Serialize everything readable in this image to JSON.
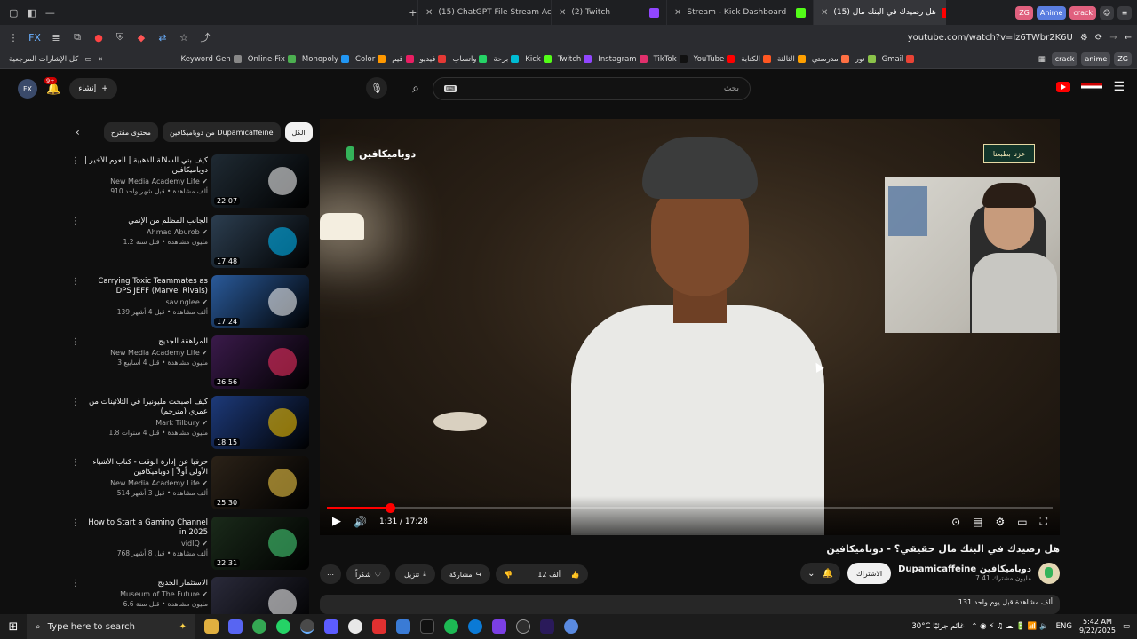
{
  "browser": {
    "tabs": [
      {
        "title": "(15) ChatGPT File Stream Acce",
        "color": "#ff0000",
        "active": false
      },
      {
        "title": "(2) Twitch",
        "color": "#9146ff",
        "active": false
      },
      {
        "title": "Stream - Kick Dashboard",
        "color": "#53fc18",
        "active": false
      },
      {
        "title": "هل رصيدك في البنك مال (15)",
        "color": "#ff0000",
        "active": true
      }
    ],
    "pills": [
      "ZG",
      "Anime",
      "crack"
    ],
    "url": "youtube.com/watch?v=lz6TWbr2K6U",
    "bookmarks": [
      "Keyword Gen",
      "Online-Fix",
      "Monopoly",
      "Color",
      "قيم",
      "فيديو",
      "واتساب",
      "برحة",
      "Kick",
      "Twitch",
      "Instagram",
      "TikTok",
      "YouTube",
      "الكتابة",
      "الثالثة",
      "مدرستي",
      "نور",
      "Gmail"
    ],
    "bookmarks_right": [
      "crack",
      "anime",
      "ZG"
    ],
    "other_bookmarks": "كل الإشارات المرجعية"
  },
  "masthead": {
    "create_label": "إنشاء",
    "notif_count": "9+",
    "search_placeholder": "بحث",
    "search_chip": "⌨"
  },
  "chips": [
    "الكل",
    "من دوباميكافين Dupamicaffeine",
    "محتوى مقترح"
  ],
  "recommendations": [
    {
      "title": "كيف بني السلالة الذهبية | العوم الأخير | دوباميكافين",
      "channel": "New Media Academy Life",
      "views": "910 ألف مشاهدة • قبل شهر واحد",
      "duration": "22:07",
      "thumb": "#1f2a33",
      "accent": "#ffffff"
    },
    {
      "title": "الجانب المظلم من الإنمي",
      "channel": "Ahmad Aburob",
      "views": "1.2 مليون مشاهدة • قبل سنة",
      "duration": "17:48",
      "thumb": "#2c3e50",
      "accent": "#00c0ff"
    },
    {
      "title": "Carrying Toxic Teammates as DPS JEFF (Marvel Rivals)",
      "channel": "savinglee",
      "views": "139 ألف مشاهدة • قبل 4 أشهر",
      "duration": "17:24",
      "thumb": "#2a5a9a",
      "accent": "#ffffff"
    },
    {
      "title": "المراهقة الجديج",
      "channel": "New Media Academy Life",
      "views": "3 مليون مشاهدة • قبل 4 أسابيع",
      "duration": "26:56",
      "thumb": "#3a1a4a",
      "accent": "#ff3366"
    },
    {
      "title": "كيف أصبحت مليونيراً في الثلاثينات من عمري (مترجم)",
      "channel": "Mark Tilbury",
      "views": "1.8 مليون مشاهدة • قبل 4 سنوات",
      "duration": "18:15",
      "thumb": "#1d3a7a",
      "accent": "#ffcc00"
    },
    {
      "title": "حرفياً عن إدارة الوقت - كتاب الأشياء الأولى أولاً | دوباميكافين",
      "channel": "New Media Academy Life",
      "views": "514 ألف مشاهدة • قبل 3 أشهر",
      "duration": "25:30",
      "thumb": "#2b2218",
      "accent": "#ffd54a"
    },
    {
      "title": "How to Start a Gaming Channel in 2025",
      "channel": "vidIQ",
      "views": "768 ألف مشاهدة • قبل 8 أشهر",
      "duration": "22:31",
      "thumb": "#1a2a1a",
      "accent": "#4ade80"
    },
    {
      "title": "الاستثمار الجديج",
      "channel": "Museum of The Future",
      "views": "6.6 مليون مشاهدة • قبل سنة",
      "duration": "",
      "thumb": "#2a2a3a",
      "accent": "#ffffff"
    }
  ],
  "video": {
    "brand": "دوباميكافين",
    "badge": "عزنا بطبعنا",
    "current": "1:31",
    "total": "17:28",
    "time_label": "1:31 / 17:28",
    "progress": 0.087,
    "title": "هل رصيدك في البنك مال حقيقي؟ - دوباميكافين"
  },
  "channel": {
    "name": "Dupamicaffeine دوباميكافين",
    "subs": "7.41 مليون مشترك",
    "subscribe_label": "الاشتراك"
  },
  "actions": {
    "likes": "12 ألف",
    "share": "مشاركة",
    "download": "تنزيل",
    "thanks": "شكراً"
  },
  "description": "131 ألف مشاهدة قبل يوم واحد",
  "taskbar": {
    "search_placeholder": "Type here to search",
    "weather": "30°C غائم جزئيًا",
    "lang": "ENG",
    "time": "5:42 AM",
    "date": "9/22/2025"
  }
}
